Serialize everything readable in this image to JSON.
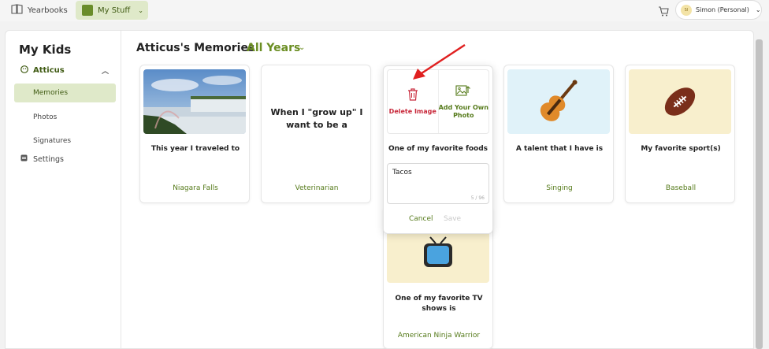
{
  "topbar": {
    "yearbooks_label": "Yearbooks",
    "mystuff_label": "My Stuff",
    "user_initials": "SI",
    "user_label": "Simon (Personal)"
  },
  "sidebar": {
    "title": "My Kids",
    "kid_name": "Atticus",
    "items": [
      {
        "label": "Memories",
        "active": true
      },
      {
        "label": "Photos",
        "active": false
      },
      {
        "label": "Signatures",
        "active": false
      }
    ],
    "settings_label": "Settings"
  },
  "content": {
    "title": "Atticus's Memories",
    "year_filter": "All Years"
  },
  "cards": [
    {
      "prompt": "This year I traveled to",
      "answer": "Niagara Falls",
      "image": "waterfall-photo"
    },
    {
      "prompt": "When I \"grow up\" I want to be a",
      "answer": "Veterinarian",
      "image": "none"
    },
    {
      "prompt": "One of my favorite foods",
      "answer": "Tacos",
      "image": "none"
    },
    {
      "prompt": "A talent that I have is",
      "answer": "Singing",
      "image": "violin-icon"
    },
    {
      "prompt": "My favorite sport(s)",
      "answer": "Baseball",
      "image": "football-icon"
    },
    {
      "prompt": "One of my favorite TV shows is",
      "answer": "American Ninja Warrior",
      "image": "tv-icon"
    }
  ],
  "popup": {
    "delete_label": "Delete Image",
    "add_label": "Add Your Own Photo",
    "prompt": "One of my favorite foods",
    "field_value": "Tacos",
    "char_count": "5 / 96",
    "cancel_label": "Cancel",
    "save_label": "Save"
  },
  "colors": {
    "brand_green": "#6b8e23",
    "active_bg": "#dfe9c9",
    "delete_red": "#c8283a",
    "annotation_arrow": "#e02020"
  }
}
